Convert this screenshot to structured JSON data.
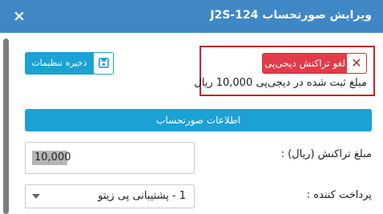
{
  "dialog": {
    "title": "ویرایش صورتحساب J2S-124",
    "close_symbol": "×"
  },
  "toolbar": {
    "save_label": "ذخیره تنظیمات",
    "save_icon": "floppy-disk-icon"
  },
  "transaction": {
    "cancel_label": "لغو تراکنش دیجی‌پی",
    "cancel_icon": "close-icon",
    "recorded_amount_text": "مبلغ ثبت شده در دیجی‌پی 10,000 ریال"
  },
  "section": {
    "title": "اطلاعات صورتحساب"
  },
  "form": {
    "amount_label": "مبلغ تراکنش (ریال) :",
    "amount_value": "10,000",
    "payer_label": "پرداخت کننده :",
    "payer_value": "1 - پشتیبانی پی زیتو"
  },
  "colors": {
    "header": "#3f88c5",
    "accent": "#1ba1d4",
    "danger": "#e23b4a",
    "danger_border": "#c0262c"
  }
}
